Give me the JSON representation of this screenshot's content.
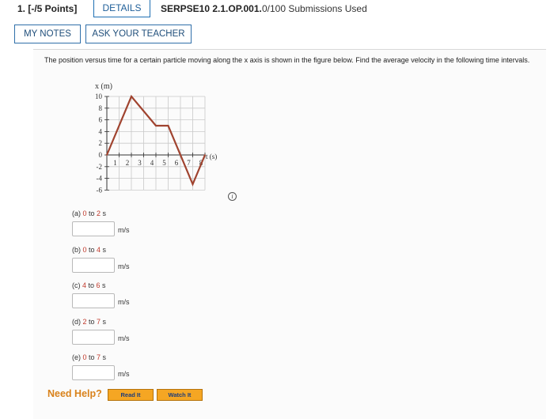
{
  "header": {
    "points": "1. [-/5 Points]",
    "details": "DETAILS",
    "code": "SERPSE10 2.1.OP.001.",
    "submissions": "0/100 Submissions Used"
  },
  "actions": {
    "my_notes": "MY NOTES",
    "ask_teacher": "ASK YOUR TEACHER"
  },
  "question": "The position versus time for a certain particle moving along the x axis is shown in the figure below. Find the average velocity in the following time intervals.",
  "chart_data": {
    "type": "line",
    "ylabel": "x (m)",
    "xlabel": "t (s)",
    "xlim": [
      0,
      8
    ],
    "ylim": [
      -6,
      10
    ],
    "x_ticks": [
      "1",
      "2",
      "3",
      "4",
      "5",
      "6",
      "7",
      "8"
    ],
    "y_ticks": [
      "10",
      "8",
      "6",
      "4",
      "2",
      "0",
      "-2",
      "-4",
      "-6"
    ],
    "grid": true,
    "line_color": "#a0432f",
    "series": [
      {
        "x": [
          0,
          2,
          4,
          5,
          7,
          8
        ],
        "values": [
          0,
          10,
          5,
          5,
          -5,
          0
        ]
      }
    ]
  },
  "parts": [
    {
      "prefix": "(a) ",
      "from": "0",
      "mid": " to ",
      "to": "2",
      "suffix": " s",
      "unit": "m/s",
      "value": ""
    },
    {
      "prefix": "(b) ",
      "from": "0",
      "mid": " to ",
      "to": "4",
      "suffix": " s",
      "unit": "m/s",
      "value": ""
    },
    {
      "prefix": "(c) ",
      "from": "4",
      "mid": " to ",
      "to": "6",
      "suffix": " s",
      "unit": "m/s",
      "value": ""
    },
    {
      "prefix": "(d) ",
      "from": "2",
      "mid": " to ",
      "to": "7",
      "suffix": " s",
      "unit": "m/s",
      "value": ""
    },
    {
      "prefix": "(e) ",
      "from": "0",
      "mid": " to ",
      "to": "7",
      "suffix": " s",
      "unit": "m/s",
      "value": ""
    }
  ],
  "help": {
    "label": "Need Help?",
    "read": "Read It",
    "watch": "Watch It"
  },
  "icons": {
    "info": "info-icon"
  }
}
